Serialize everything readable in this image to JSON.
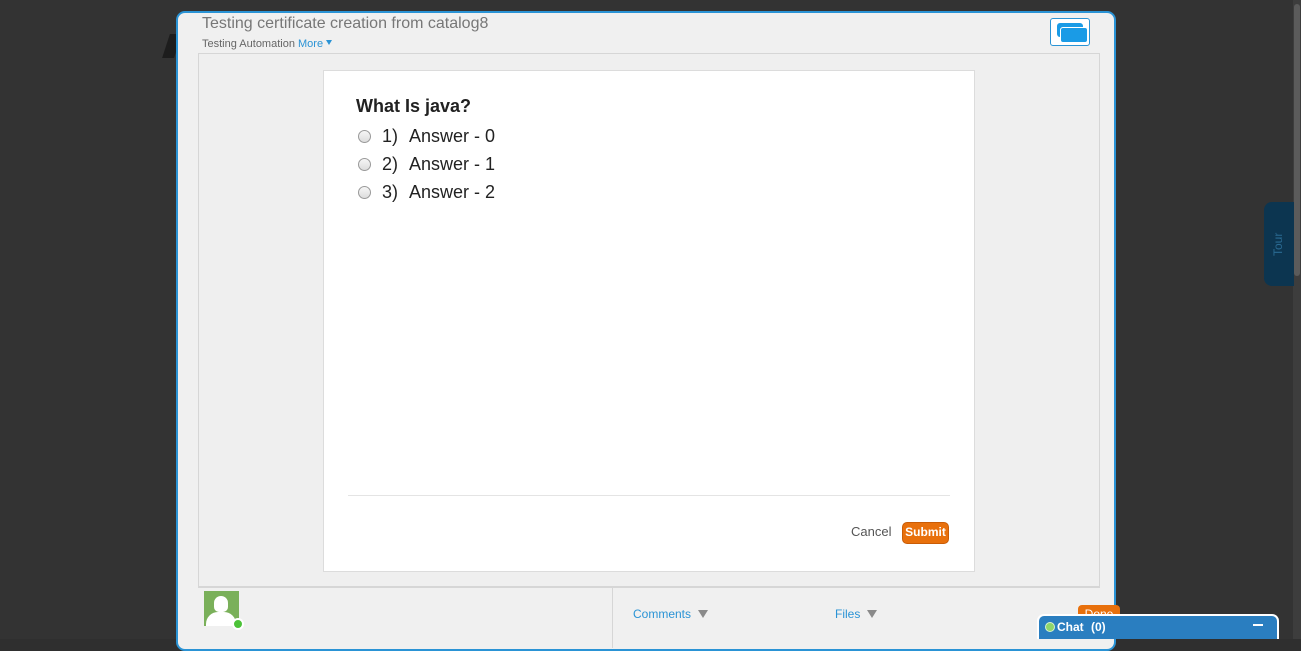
{
  "header": {
    "title": "Testing certificate creation from catalog8",
    "subtitle": "Testing Automation",
    "more_label": "More"
  },
  "side": {
    "tour_label": "Tour"
  },
  "quiz": {
    "question": "What Is java?",
    "options": [
      {
        "number": "1)",
        "label": "Answer - 0",
        "selected": false
      },
      {
        "number": "2)",
        "label": "Answer - 1",
        "selected": false
      },
      {
        "number": "3)",
        "label": "Answer - 2",
        "selected": false
      }
    ],
    "cancel_label": "Cancel",
    "submit_label": "Submit"
  },
  "footer": {
    "comments_label": "Comments",
    "files_label": "Files",
    "done_label": "Done"
  },
  "chat": {
    "label": "Chat",
    "count": "(0)"
  },
  "colors": {
    "accent": "#2a93d5",
    "submit": "#e8700c",
    "chat_bar": "#2a7ec0"
  },
  "icons": {
    "view_toggle": "windows-icon",
    "avatar": "user-silhouette-icon",
    "caret": "caret-down-icon",
    "minimize": "minimize-icon"
  }
}
